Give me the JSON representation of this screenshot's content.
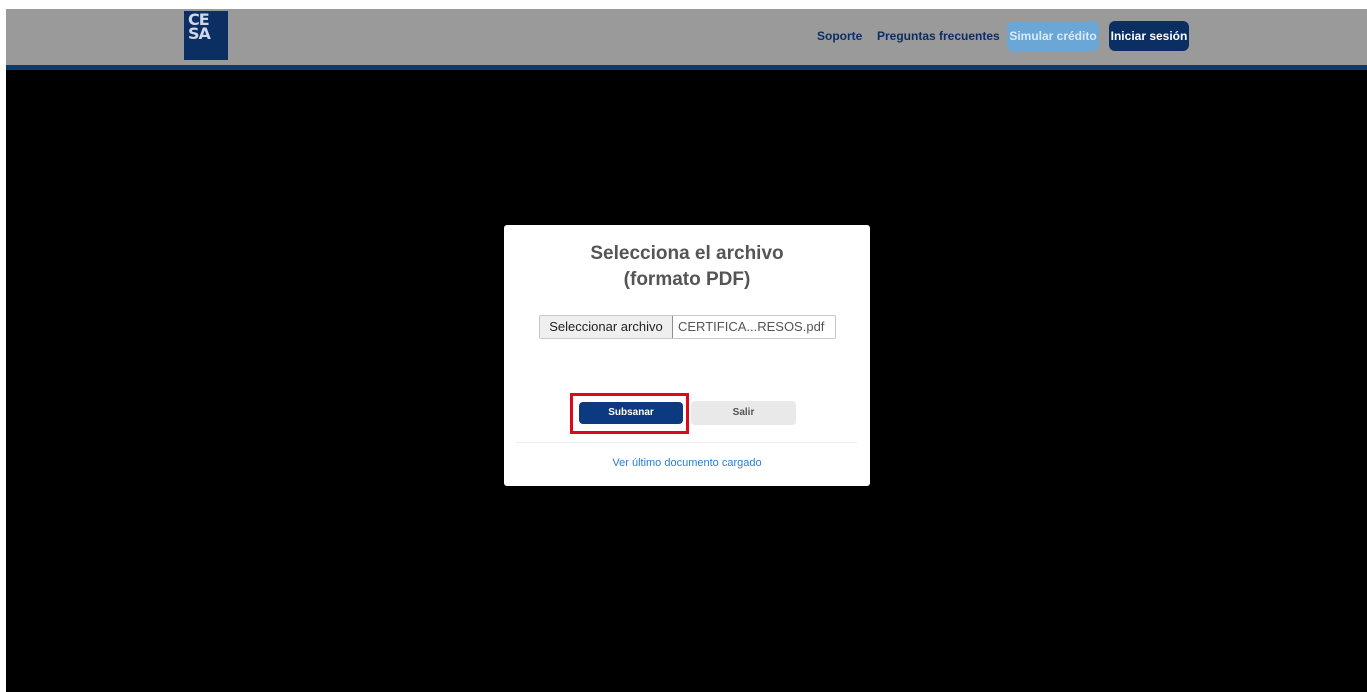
{
  "navbar": {
    "logo_text": "CE SA",
    "links": [
      "Soporte",
      "Preguntas frecuentes"
    ],
    "simulate_button": "Simular crédito",
    "login_button": "Iniciar sesión"
  },
  "modal": {
    "title_line1": "Selecciona el archivo",
    "title_line2": "(formato PDF)",
    "file_input": {
      "button_label": "Seleccionar archivo",
      "file_name": "CERTIFICA...RESOS.pdf"
    },
    "submit_button": "Subsanar",
    "cancel_button": "Salir",
    "last_document_link": "Ver último documento cargado"
  },
  "colors": {
    "brand_navy": "#0b2f63",
    "highlight": "#e0071b",
    "link_blue": "#2a7dd2"
  }
}
